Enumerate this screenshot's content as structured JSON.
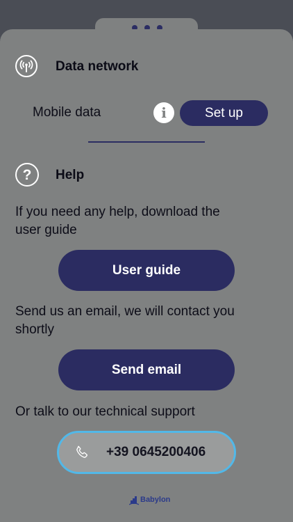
{
  "data_network": {
    "title": "Data network",
    "mobile_data_label": "Mobile data",
    "setup_button_label": "Set up"
  },
  "help": {
    "title": "Help",
    "guide_text": "If you need any help, download the user guide",
    "guide_button_label": "User guide",
    "email_text": "Send us an email, we will contact you shortly",
    "email_button_label": "Send email",
    "support_text": "Or talk to our technical support",
    "phone_number": "+39 0645200406"
  },
  "footer": {
    "brand": "Babylon"
  },
  "icons": {
    "data_network": "antenna-icon",
    "info": "info-icon",
    "help": "question-icon",
    "phone": "phone-icon",
    "brand": "babylon-logo-icon"
  },
  "colors": {
    "accent": "#2b2c61",
    "sheet_background": "#7f8181",
    "phone_border": "#52b8e8"
  }
}
